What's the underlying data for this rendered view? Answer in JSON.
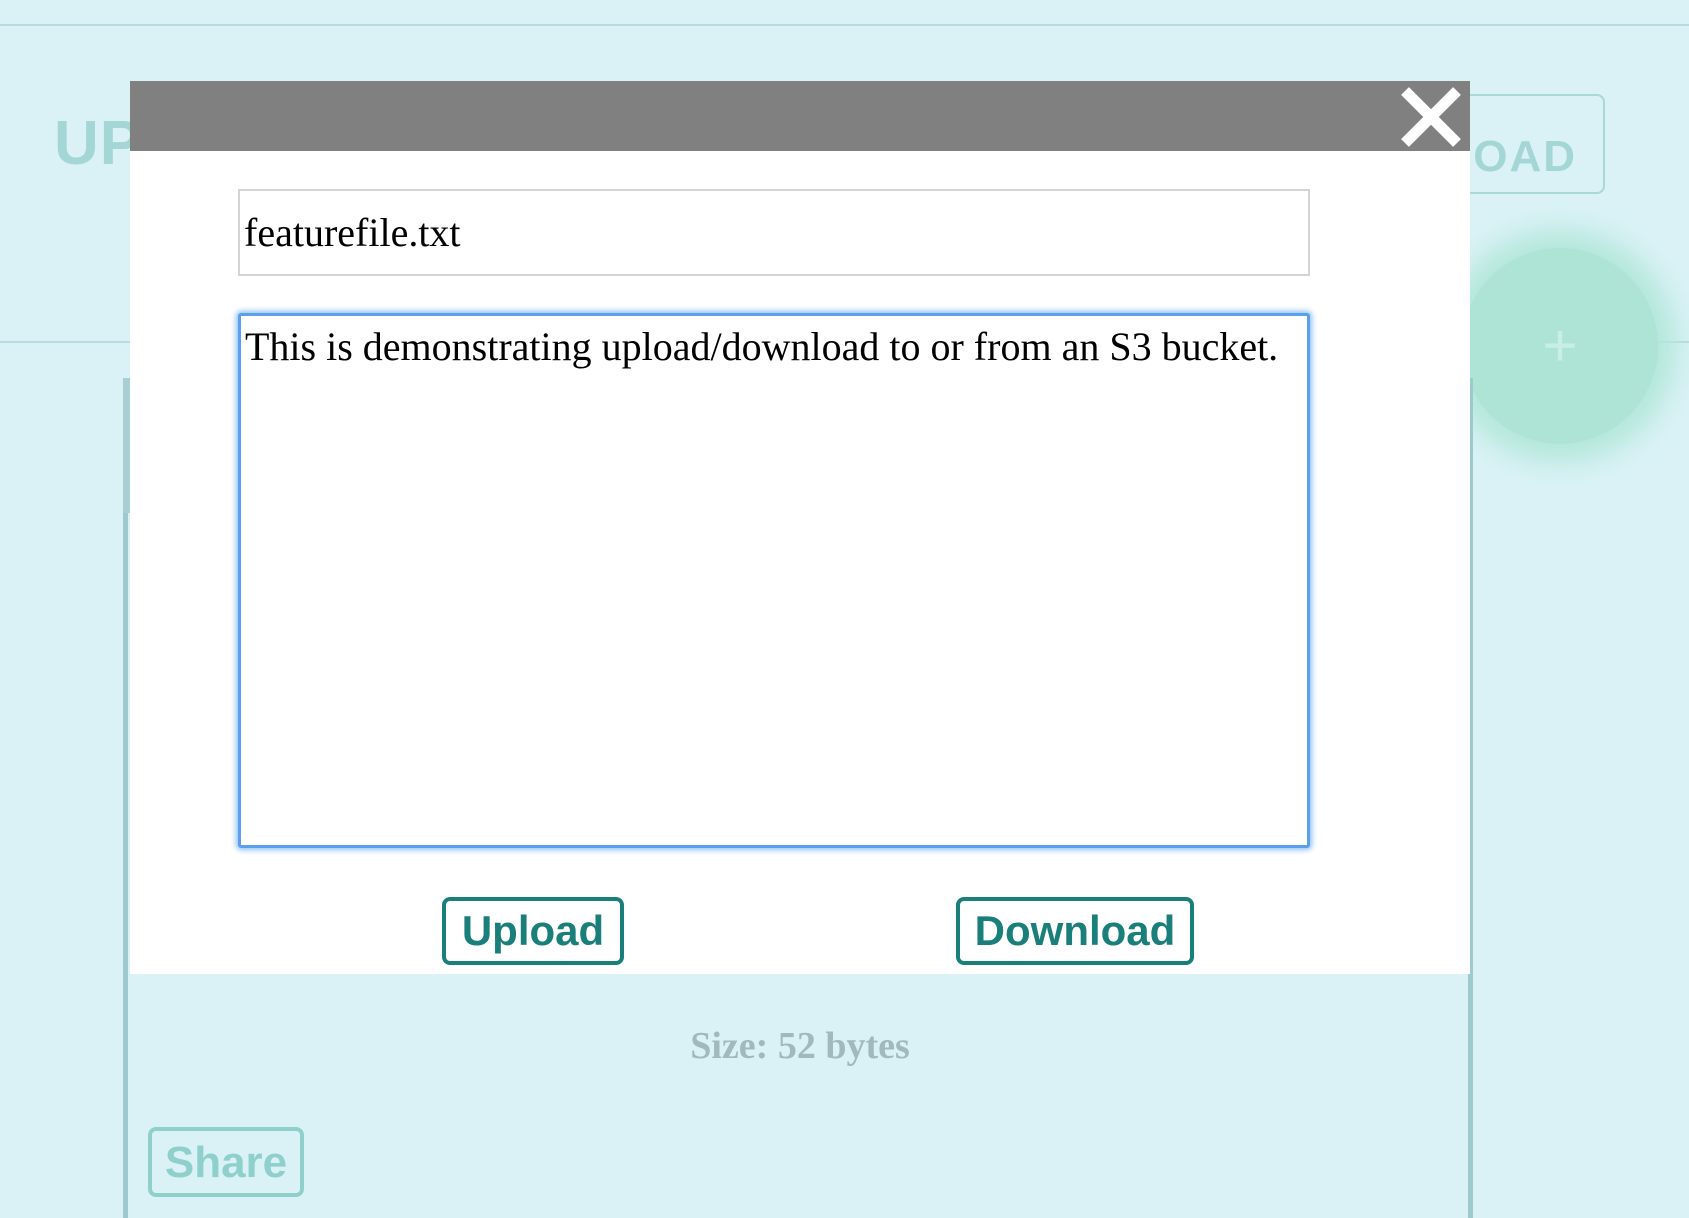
{
  "background": {
    "upload_heading": "UP",
    "download_button_label": "LOAD",
    "fab_icon": "plus-icon",
    "size_label": "Size: 52 bytes",
    "share_button_label": "Share"
  },
  "modal": {
    "close_icon": "close-icon",
    "filename_value": "featurefile.txt",
    "content_value": "This is demonstrating upload/download to or from an S3 bucket.",
    "upload_button_label": "Upload",
    "download_button_label": "Download"
  },
  "colors": {
    "page_background": "#daf2f6",
    "modal_header": "#808080",
    "button_accent": "#1a7e7a",
    "textarea_focus": "#5aa0ec"
  }
}
